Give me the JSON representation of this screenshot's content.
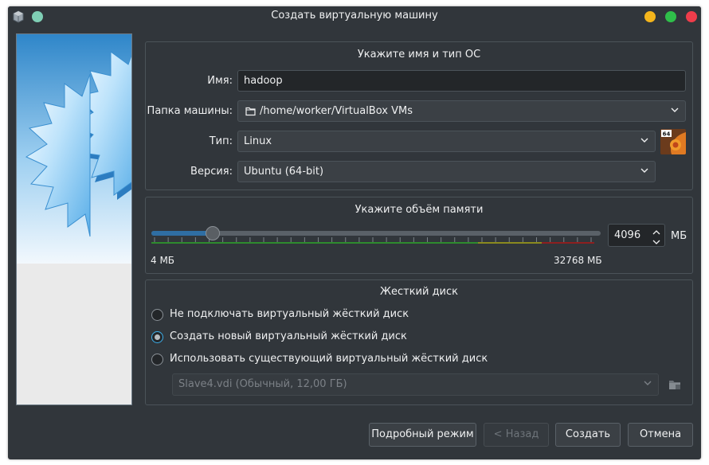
{
  "window": {
    "title": "Создать виртуальную машину"
  },
  "name_os": {
    "heading": "Укажите имя и тип ОС",
    "name_label": "Имя:",
    "name_value": "hadoop",
    "folder_label": "Папка машины:",
    "folder_value": "/home/worker/VirtualBox VMs",
    "type_label": "Тип:",
    "type_value": "Linux",
    "os_badge": "64",
    "version_label": "Версия:",
    "version_value": "Ubuntu (64-bit)"
  },
  "memory": {
    "heading": "Укажите объём памяти",
    "value": "4096",
    "unit": "МБ",
    "min_label": "4 МБ",
    "max_label": "32768 МБ",
    "min_mb": 4,
    "max_mb": 32768,
    "current_mb": 4096
  },
  "disk": {
    "heading": "Жесткий диск",
    "options": [
      "Не подключать виртуальный жёсткий диск",
      "Создать новый виртуальный жёсткий диск",
      "Использовать существующий виртуальный жёсткий диск"
    ],
    "selected_index": 1,
    "existing_value": "Slave4.vdi (Обычный, 12,00 ГБ)"
  },
  "buttons": {
    "expert": "Подробный режим",
    "back": "< Назад",
    "create": "Создать",
    "cancel": "Отмена"
  }
}
